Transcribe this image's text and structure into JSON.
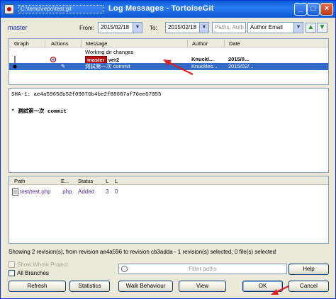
{
  "window": {
    "title": "Log Messages - TortoiseGit",
    "path": "C:\\temp\\repo\\test.git"
  },
  "toolbar": {
    "branch": "master",
    "from_label": "From:",
    "from_date": "2015/02/18",
    "to_label": "To:",
    "to_date": "2015/02/18",
    "search_placeholder": "Paths, Auth",
    "search_by": "Author Email"
  },
  "log_grid": {
    "columns": [
      "Graph",
      "Actions",
      "Message",
      "Author",
      "Date"
    ],
    "rows": [
      {
        "message": "Working dir changes",
        "author": "",
        "date": ""
      },
      {
        "tag": "master",
        "message": "ver2",
        "author": "Knuckl...",
        "date": "2015/0..."
      },
      {
        "message": "測試第一次 commit",
        "author": "Knuckles...",
        "date": "2015/02/..."
      }
    ]
  },
  "commit_detail": {
    "sha": "SHA-1: ae4a59656b52f09076b4be2f88687af76ee67055",
    "message": "* 測試第一次 commit"
  },
  "files": {
    "columns": [
      "Path",
      "E...",
      "Status",
      "L",
      "L"
    ],
    "rows": [
      {
        "path": "test/test.php",
        "ext": ".php",
        "status": "Added",
        "added": "3",
        "removed": "0"
      }
    ]
  },
  "status_text": "Showing 2 revision(s), from revision ae4a596 to revision cb3adda - 1 revision(s) selected, 0 file(s) selected",
  "options": {
    "show_whole_project": "Show Whole Project",
    "all_branches": "All Branches"
  },
  "filter_placeholder": "Filter paths",
  "buttons": {
    "help": "Help",
    "refresh": "Refresh",
    "statistics": "Statistics",
    "walk_behaviour": "Walk Behaviour",
    "view": "View",
    "ok": "OK",
    "cancel": "Cancel"
  },
  "colors": {
    "selection": "#316ac5",
    "tag_master": "#c00000",
    "annotation_arrow": "#e02020"
  }
}
